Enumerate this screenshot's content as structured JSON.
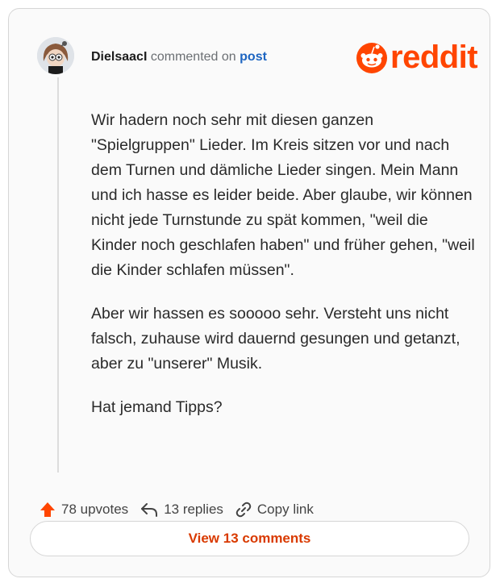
{
  "comment": {
    "author": "DielsaacI",
    "action_text": "commented on",
    "post_link": "post",
    "paragraphs": [
      "Wir hadern noch sehr mit diesen ganzen \"Spielgruppen\" Lieder. Im Kreis sitzen vor und nach dem Turnen und dämliche Lieder singen. Mein Mann und ich hasse es leider beide. Aber glaube, wir können nicht jede Turnstunde zu spät kommen, \"weil die Kinder noch geschlafen haben\" und früher gehen, \"weil die Kinder schlafen müssen\".",
      "Aber wir hassen es sooooo sehr. Versteht uns nicht falsch, zuhause wird dauernd gesungen und getanzt, aber zu \"unserer\" Musik.",
      "Hat jemand Tipps?"
    ]
  },
  "brand": {
    "name": "reddit",
    "color": "#ff4500"
  },
  "actions": {
    "upvotes": "78 upvotes",
    "replies": "13 replies",
    "copy_link": "Copy link"
  },
  "footer": {
    "view_comments_label": "View 13 comments"
  },
  "icons": [
    "avatar",
    "reddit-logo-icon",
    "upvote-icon",
    "reply-icon",
    "link-icon"
  ]
}
